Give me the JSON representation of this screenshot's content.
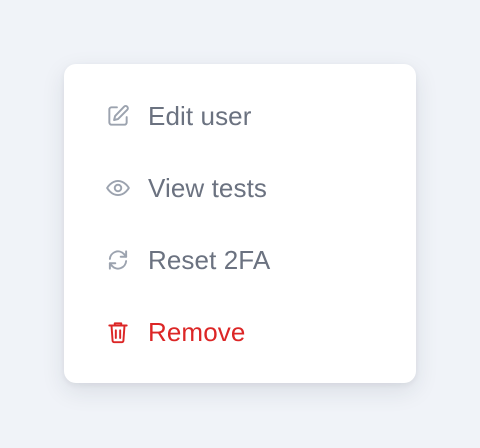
{
  "menu": {
    "items": [
      {
        "label": "Edit user",
        "icon": "edit-icon"
      },
      {
        "label": "View tests",
        "icon": "eye-icon"
      },
      {
        "label": "Reset 2FA",
        "icon": "refresh-icon"
      },
      {
        "label": "Remove",
        "icon": "trash-icon"
      }
    ]
  },
  "colors": {
    "background": "#f0f3f8",
    "menu_background": "#ffffff",
    "text": "#6b7280",
    "icon": "#9ca3af",
    "danger": "#dc2626"
  }
}
